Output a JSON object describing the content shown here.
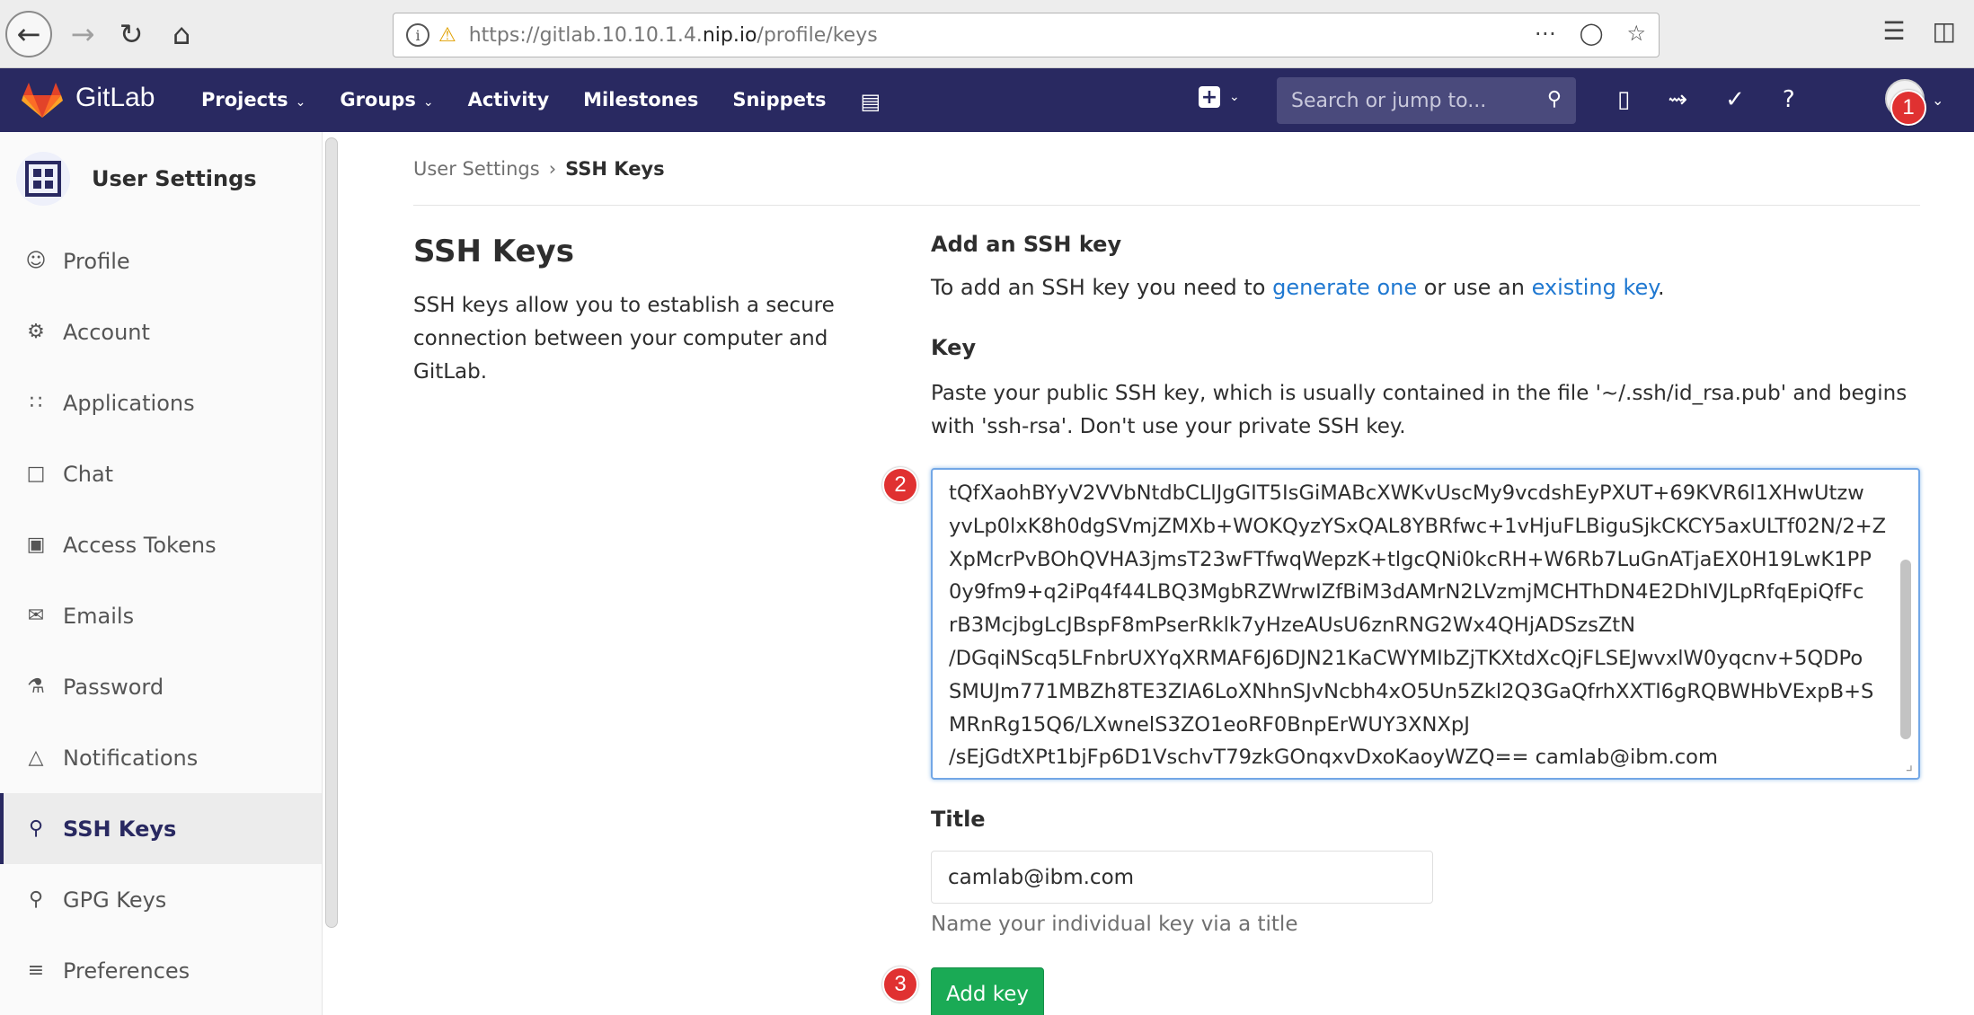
{
  "browser": {
    "url_prefix": "https://gitlab.10.10.1.4.",
    "url_domain": "nip.io",
    "url_path": "/profile/keys"
  },
  "nav": {
    "brand": "GitLab",
    "menu": [
      "Projects",
      "Groups",
      "Activity",
      "Milestones",
      "Snippets"
    ],
    "search_placeholder": "Search or jump to..."
  },
  "sidebar": {
    "title": "User Settings",
    "items": [
      {
        "label": "Profile",
        "icon": "profile-icon"
      },
      {
        "label": "Account",
        "icon": "account-icon"
      },
      {
        "label": "Applications",
        "icon": "applications-icon"
      },
      {
        "label": "Chat",
        "icon": "chat-icon"
      },
      {
        "label": "Access Tokens",
        "icon": "access-tokens-icon"
      },
      {
        "label": "Emails",
        "icon": "emails-icon"
      },
      {
        "label": "Password",
        "icon": "password-icon"
      },
      {
        "label": "Notifications",
        "icon": "notifications-icon"
      },
      {
        "label": "SSH Keys",
        "icon": "key-icon"
      },
      {
        "label": "GPG Keys",
        "icon": "key-icon"
      },
      {
        "label": "Preferences",
        "icon": "preferences-icon"
      }
    ],
    "active": "SSH Keys"
  },
  "breadcrumb": {
    "parent": "User Settings",
    "current": "SSH Keys"
  },
  "left": {
    "title": "SSH Keys",
    "description": "SSH keys allow you to establish a secure connection between your computer and GitLab."
  },
  "form": {
    "add_heading": "Add an SSH key",
    "add_desc_prefix": "To add an SSH key you need to ",
    "generate_link": "generate one",
    "add_desc_mid": " or use an ",
    "existing_link": "existing key",
    "add_desc_suffix": ".",
    "key_label": "Key",
    "key_help": "Paste your public SSH key, which is usually contained in the file '~/.ssh/id_rsa.pub' and begins with 'ssh-rsa'. Don't use your private SSH key.",
    "key_value": "tQfXaohBYyV2VVbNtdbCLlJgGIT5IsGiMABcXWKvUscMy9vcdshEyPXUT+69KVR6l1XHwUtzw\nyvLp0lxK8h0dgSVmjZMXb+WOKQyzYSxQAL8YBRfwc+1vHjuFLBiguSjkCKCY5axULTf02N/2+Z\nXpMcrPvBOhQVHA3jmsT23wFTfwqWepzK+tlgcQNi0kcRH+W6Rb7LuGnATjaEX0H19LwK1PP\n0y9fm9+q2iPq4f44LBQ3MgbRZWrwIZfBiM3dAMrN2LVzmjMCHThDN4E2DhIVJLpRfqEpiQfFc\nrB3McjbgLcJBspF8mPserRklk7yHzeAUsU6znRNG2Wx4QHjADSzsZtN\n/DGqiNScq5LFnbrUXYqXRMAF6J6DJN21KaCWYMIbZjTKXtdXcQjFLSEJwvxlW0yqcnv+5QDPo\nSMUJm771MBZh8TE3ZIA6LoXNhnSJvNcbh4xO5Un5Zkl2Q3GaQfrhXXTl6gRQBWHbVExpB+S\nMRnRg15Q6/LXwnelS3ZO1eoRF0BnpErWUY3XNXpJ\n/sEjGdtXPt1bjFp6D1VschvT79zkGOnqxvDxoKaoyWZQ== camlab@ibm.com",
    "title_label": "Title",
    "title_value": "camlab@ibm.com",
    "title_hint": "Name your individual key via a title",
    "submit_label": "Add key"
  },
  "markers": [
    "1",
    "2",
    "3"
  ],
  "colors": {
    "nav_bg": "#292961",
    "link": "#1f78d1",
    "success": "#1aaa55",
    "marker": "#e03131"
  }
}
